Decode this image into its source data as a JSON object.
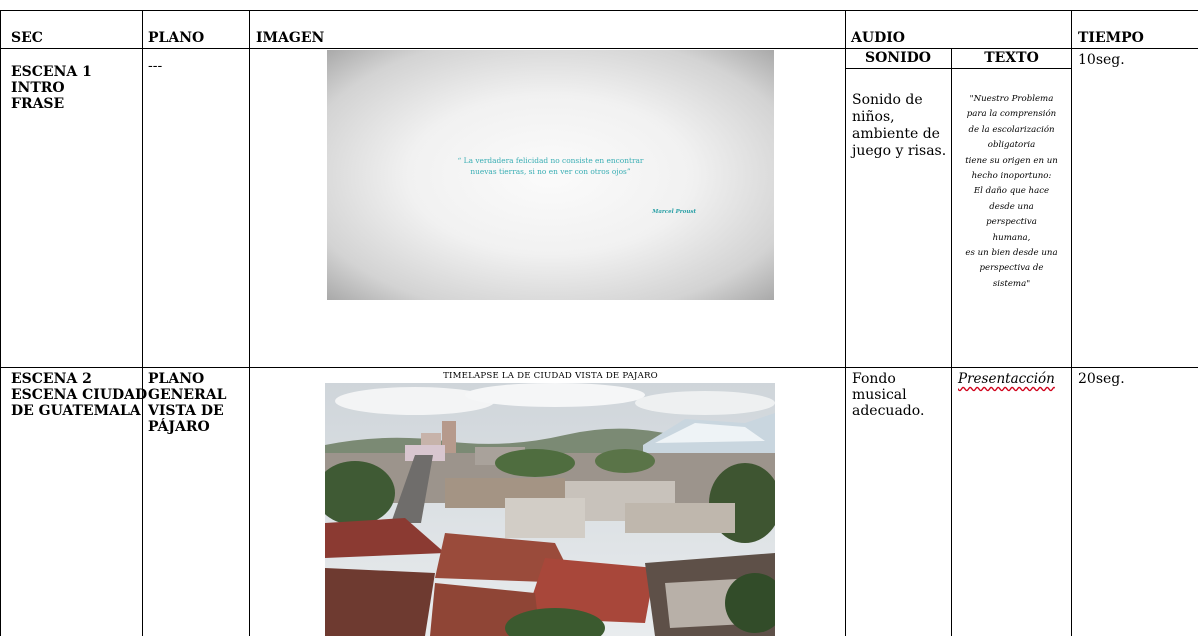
{
  "table": {
    "headers": {
      "sec": "SEC",
      "plano": "PLANO",
      "imagen": "IMAGEN",
      "audio": "AUDIO",
      "tiempo": "TIEMPO"
    },
    "audio_subheaders": {
      "sonido": "SONIDO",
      "texto": "TEXTO"
    },
    "rows": [
      {
        "sec": [
          "ESCENA 1",
          "INTRO",
          "FRASE"
        ],
        "plano": "---",
        "imagen": {
          "quote_lines": [
            "“ La verdadera felicidad no consiste en encontrar",
            "nuevas tierras, si no en ver con otros ojos”"
          ],
          "author": "Marcel Proust"
        },
        "sonido": [
          "Sonido de",
          "niños,",
          "ambiente de",
          "juego y risas."
        ],
        "texto": [
          "\"Nuestro Problema",
          "para la comprensión",
          "de la escolarización",
          "obligatoria",
          "tiene su origen en un",
          "hecho inoportuno:",
          "El daño que hace",
          "desde una",
          "perspectiva",
          "humana,",
          "es un bien desde una",
          "perspectiva de",
          "sistema\""
        ],
        "tiempo": "10seg."
      },
      {
        "sec": [
          "ESCENA 2",
          "ESCENA CIUDAD",
          "DE GUATEMALA"
        ],
        "plano": [
          "PLANO",
          "GENERAL",
          "VISTA DE",
          "PÁJARO"
        ],
        "imagen": {
          "caption": "TIMELAPSE LA DE CIUDAD VISTA DE PAJARO"
        },
        "sonido": [
          "Fondo",
          "musical",
          "adecuado."
        ],
        "texto": "Presentacción",
        "tiempo": "20seg."
      }
    ]
  },
  "colors": {
    "quote_text": "#3aaeb4",
    "spellcheck_underline": "#d0021b"
  }
}
